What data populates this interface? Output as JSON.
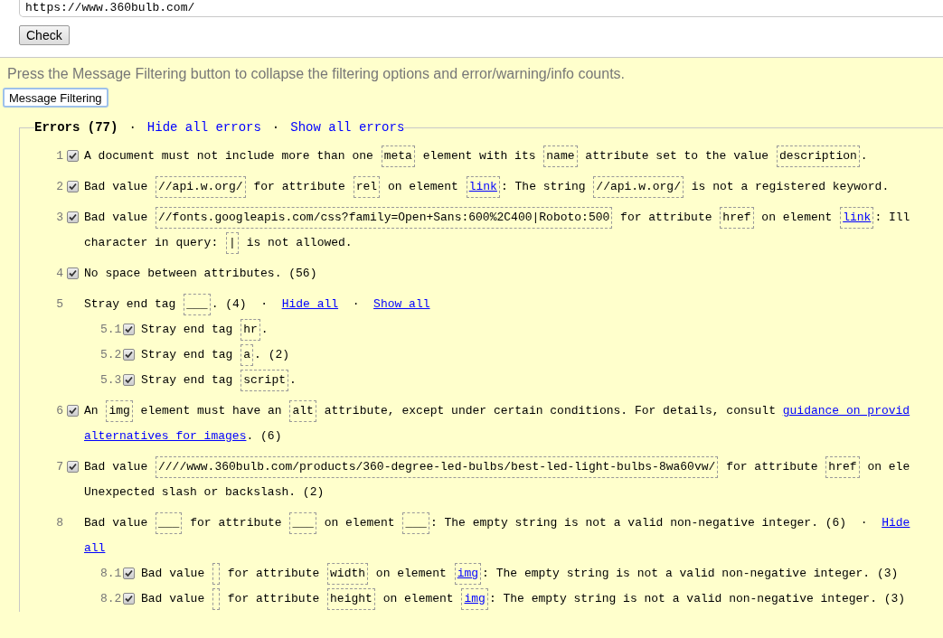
{
  "url_field": {
    "value": "https://www.360bulb.com/"
  },
  "check_button": "Check",
  "hint": "Press the Message Filtering button to collapse the filtering options and error/warning/info counts.",
  "filter_button": "Message Filtering",
  "errors": {
    "legend": [
      {
        "kind": "title",
        "text": "Errors (77)"
      },
      {
        "kind": "sep",
        "text": "·"
      },
      {
        "kind": "link",
        "text": "Hide all errors"
      },
      {
        "kind": "sep",
        "text": "·"
      },
      {
        "kind": "link",
        "text": "Show all errors"
      }
    ],
    "items": [
      {
        "number": "1",
        "kind": "message",
        "checked": true,
        "lines": [
          [
            {
              "kind": "text",
              "text": "A document must not include more than one "
            },
            {
              "kind": "code",
              "text": "meta"
            },
            {
              "kind": "text",
              "text": " element with its "
            },
            {
              "kind": "code",
              "text": "name"
            },
            {
              "kind": "text",
              "text": " attribute set to the value "
            },
            {
              "kind": "code",
              "text": "description"
            },
            {
              "kind": "text",
              "text": "."
            }
          ]
        ]
      },
      {
        "number": "2",
        "kind": "message",
        "checked": true,
        "lines": [
          [
            {
              "kind": "text",
              "text": "Bad value "
            },
            {
              "kind": "code",
              "text": "//api.w.org/"
            },
            {
              "kind": "text",
              "text": " for attribute "
            },
            {
              "kind": "code",
              "text": "rel"
            },
            {
              "kind": "text",
              "text": " on element "
            },
            {
              "kind": "codelink",
              "text": "link"
            },
            {
              "kind": "text",
              "text": ": The string "
            },
            {
              "kind": "code",
              "text": "//api.w.org/"
            },
            {
              "kind": "text",
              "text": " is not a registered keyword."
            }
          ]
        ]
      },
      {
        "number": "3",
        "kind": "message",
        "checked": true,
        "lines": [
          [
            {
              "kind": "text",
              "text": "Bad value "
            },
            {
              "kind": "code",
              "text": "//fonts.googleapis.com/css?family=Open+Sans:600%2C400|Roboto:500"
            },
            {
              "kind": "text",
              "text": " for attribute "
            },
            {
              "kind": "code",
              "text": "href"
            },
            {
              "kind": "text",
              "text": " on element "
            },
            {
              "kind": "codelink",
              "text": "link"
            },
            {
              "kind": "text",
              "text": ": Ill"
            }
          ],
          [
            {
              "kind": "text",
              "text": "character in query: "
            },
            {
              "kind": "code",
              "text": "|"
            },
            {
              "kind": "text",
              "text": " is not allowed."
            }
          ]
        ]
      },
      {
        "number": "4",
        "kind": "message",
        "checked": true,
        "lines": [
          [
            {
              "kind": "text",
              "text": "No space between attributes. (56)"
            }
          ]
        ]
      },
      {
        "number": "5",
        "kind": "group",
        "lines": [
          [
            {
              "kind": "text",
              "text": "Stray end tag "
            },
            {
              "kind": "code",
              "text": "___"
            },
            {
              "kind": "text",
              "text": ". (4)  ·  "
            },
            {
              "kind": "link",
              "text": "Hide all"
            },
            {
              "kind": "text",
              "text": "  ·  "
            },
            {
              "kind": "link",
              "text": "Show all"
            }
          ]
        ],
        "children": [
          {
            "number": "5.1",
            "checked": true,
            "lines": [
              [
                {
                  "kind": "text",
                  "text": "Stray end tag "
                },
                {
                  "kind": "code",
                  "text": "hr"
                },
                {
                  "kind": "text",
                  "text": "."
                }
              ]
            ]
          },
          {
            "number": "5.2",
            "checked": true,
            "lines": [
              [
                {
                  "kind": "text",
                  "text": "Stray end tag "
                },
                {
                  "kind": "code",
                  "text": "a"
                },
                {
                  "kind": "text",
                  "text": ". (2)"
                }
              ]
            ]
          },
          {
            "number": "5.3",
            "checked": true,
            "lines": [
              [
                {
                  "kind": "text",
                  "text": "Stray end tag "
                },
                {
                  "kind": "code",
                  "text": "script"
                },
                {
                  "kind": "text",
                  "text": "."
                }
              ]
            ]
          }
        ]
      },
      {
        "number": "6",
        "kind": "message",
        "checked": true,
        "lines": [
          [
            {
              "kind": "text",
              "text": "An "
            },
            {
              "kind": "code",
              "text": "img"
            },
            {
              "kind": "text",
              "text": " element must have an "
            },
            {
              "kind": "code",
              "text": "alt"
            },
            {
              "kind": "text",
              "text": " attribute, except under certain conditions. For details, consult "
            },
            {
              "kind": "link",
              "text": "guidance on provid"
            }
          ],
          [
            {
              "kind": "link",
              "text": "alternatives for images"
            },
            {
              "kind": "text",
              "text": ". (6)"
            }
          ]
        ]
      },
      {
        "number": "7",
        "kind": "message",
        "checked": true,
        "lines": [
          [
            {
              "kind": "text",
              "text": "Bad value "
            },
            {
              "kind": "code",
              "text": "////www.360bulb.com/products/360-degree-led-bulbs/best-led-light-bulbs-8wa60vw/"
            },
            {
              "kind": "text",
              "text": " for attribute "
            },
            {
              "kind": "code",
              "text": "href"
            },
            {
              "kind": "text",
              "text": " on ele"
            }
          ],
          [
            {
              "kind": "text",
              "text": "Unexpected slash or backslash. (2)"
            }
          ]
        ]
      },
      {
        "number": "8",
        "kind": "group",
        "lines": [
          [
            {
              "kind": "text",
              "text": "Bad value "
            },
            {
              "kind": "code",
              "text": "___"
            },
            {
              "kind": "text",
              "text": " for attribute "
            },
            {
              "kind": "code",
              "text": "___"
            },
            {
              "kind": "text",
              "text": " on element "
            },
            {
              "kind": "code",
              "text": "___"
            },
            {
              "kind": "text",
              "text": ": The empty string is not a valid non-negative integer. (6)  ·  "
            },
            {
              "kind": "link",
              "text": "Hide"
            }
          ],
          [
            {
              "kind": "link",
              "text": "all"
            }
          ]
        ],
        "children": [
          {
            "number": "8.1",
            "checked": true,
            "lines": [
              [
                {
                  "kind": "text",
                  "text": "Bad value "
                },
                {
                  "kind": "empty"
                },
                {
                  "kind": "text",
                  "text": " for attribute "
                },
                {
                  "kind": "code",
                  "text": "width"
                },
                {
                  "kind": "text",
                  "text": " on element "
                },
                {
                  "kind": "codelink",
                  "text": "img"
                },
                {
                  "kind": "text",
                  "text": ": The empty string is not a valid non-negative integer. (3)"
                }
              ]
            ]
          },
          {
            "number": "8.2",
            "checked": true,
            "lines": [
              [
                {
                  "kind": "text",
                  "text": "Bad value "
                },
                {
                  "kind": "empty"
                },
                {
                  "kind": "text",
                  "text": " for attribute "
                },
                {
                  "kind": "code",
                  "text": "height"
                },
                {
                  "kind": "text",
                  "text": " on element "
                },
                {
                  "kind": "codelink",
                  "text": "img"
                },
                {
                  "kind": "text",
                  "text": ": The empty string is not a valid non-negative integer. (3)"
                }
              ]
            ]
          }
        ]
      }
    ]
  }
}
